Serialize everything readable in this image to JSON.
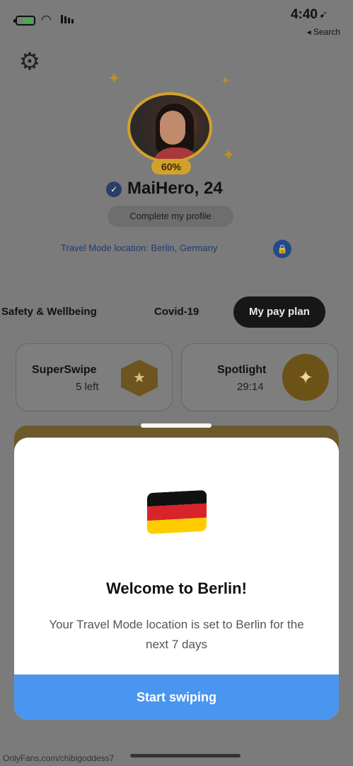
{
  "status_bar": {
    "time": "4:40",
    "back_label": "◂ Search"
  },
  "profile": {
    "name": "MaiHero, 24",
    "completion_percent": "60%",
    "complete_button": "Complete my profile",
    "travel_mode": "Travel Mode location: Berlin, Germany"
  },
  "tabs": [
    {
      "label": "My pay plan"
    },
    {
      "label": "Covid-19"
    },
    {
      "label": "Safety & Wellbeing"
    }
  ],
  "cards": {
    "spotlight": {
      "title": "Spotlight",
      "value": "29:14"
    },
    "superswipe": {
      "title": "SuperSwipe",
      "value": "5 left"
    }
  },
  "modal": {
    "heading": "Welcome to Berlin!",
    "body": "Your Travel Mode location is set to Berlin for the next 7 days",
    "button": "Start swiping"
  },
  "watermark": "OnlyFans.com/chibigoddess7",
  "colors": {
    "accent_gold": "#d2a12c",
    "button_blue": "#4a95ef"
  }
}
